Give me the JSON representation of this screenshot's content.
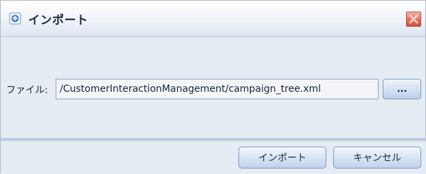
{
  "dialog": {
    "title": "インポート",
    "title_icon": "import-icon",
    "close_icon": "close-icon"
  },
  "file_row": {
    "label": "ファイル:",
    "value": "/CustomerInteractionManagement/campaign_tree.xml",
    "browse_label": "..."
  },
  "buttons": {
    "import_label": "インポート",
    "cancel_label": "キャンセル"
  },
  "colors": {
    "close_button": "#e26e57",
    "button_face": "#d6e3f4",
    "dialog_background": "#e6ecf4"
  }
}
